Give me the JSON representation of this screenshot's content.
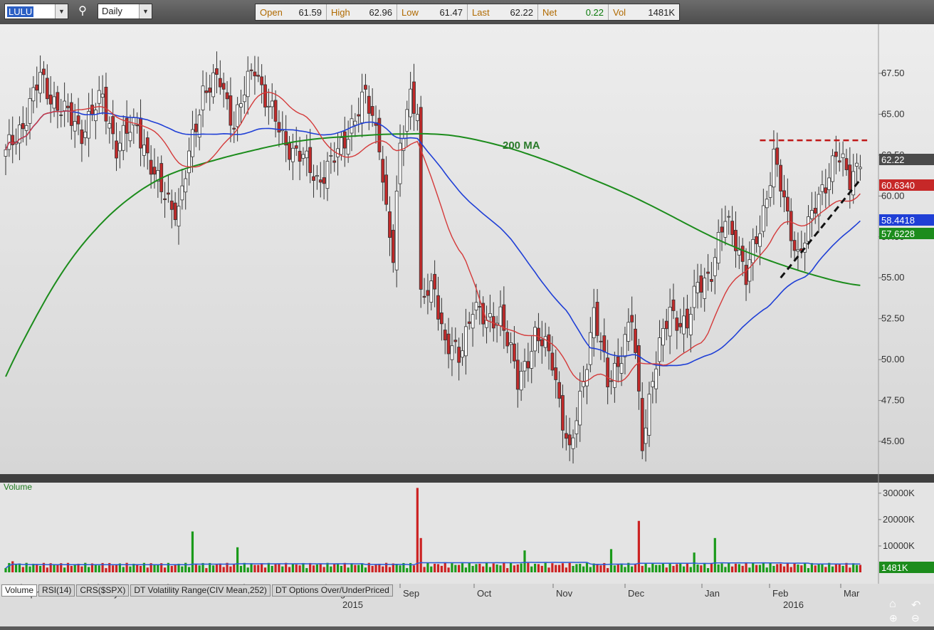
{
  "toolbar": {
    "symbol": "LULU",
    "period": "Daily",
    "quote": [
      {
        "label": "Open",
        "value": "61.59"
      },
      {
        "label": "High",
        "value": "62.96"
      },
      {
        "label": "Low",
        "value": "61.47"
      },
      {
        "label": "Last",
        "value": "62.22"
      },
      {
        "label": "Net",
        "value": "0.22"
      },
      {
        "label": "Vol",
        "value": "1481K"
      }
    ]
  },
  "colors": {
    "up": "#ffffff",
    "down": "#c12a2a",
    "ma20": "#d43a3a",
    "ma50": "#1f3fd6",
    "ma200": "#1c8c1c",
    "plot_bg": "#e8e8e8",
    "volume_avg": "#2a5bd8"
  },
  "chart_data": [
    {
      "type": "candlestick",
      "title": "",
      "xlabel": "",
      "ylabel": "",
      "ylim": [
        43.0,
        70.5
      ],
      "yticks": [
        "45.00",
        "47.50",
        "50.00",
        "52.50",
        "55.00",
        "57.50",
        "60.00",
        "62.50",
        "65.00",
        "67.50"
      ],
      "x_month_labels": [
        "Apr",
        "May",
        "Jun",
        "Jul",
        "Aug",
        "Sep",
        "Oct",
        "Nov",
        "Dec",
        "Jan",
        "Feb",
        "Mar"
      ],
      "x_year_labels": [
        "2015",
        "2016"
      ],
      "price_anchor_points": [
        [
          0,
          62.5
        ],
        [
          5,
          64.5
        ],
        [
          10,
          67.2
        ],
        [
          15,
          65.5
        ],
        [
          22,
          64.0
        ],
        [
          28,
          66.0
        ],
        [
          32,
          63.0
        ],
        [
          38,
          64.5
        ],
        [
          43,
          61.0
        ],
        [
          50,
          59.0
        ],
        [
          54,
          63.5
        ],
        [
          57,
          66.5
        ],
        [
          62,
          67.0
        ],
        [
          66,
          64.5
        ],
        [
          72,
          68.0
        ],
        [
          76,
          65.5
        ],
        [
          80,
          63.5
        ],
        [
          85,
          62.5
        ],
        [
          90,
          61.0
        ],
        [
          96,
          62.5
        ],
        [
          100,
          64.5
        ],
        [
          104,
          66.0
        ],
        [
          108,
          63.5
        ],
        [
          110,
          59.0
        ],
        [
          112,
          56.0
        ],
        [
          114,
          63.0
        ],
        [
          117,
          66.5
        ],
        [
          119,
          65.0
        ],
        [
          120,
          53.5
        ],
        [
          124,
          54.5
        ],
        [
          127,
          51.0
        ],
        [
          131,
          50.0
        ],
        [
          135,
          53.5
        ],
        [
          139,
          52.0
        ],
        [
          143,
          53.0
        ],
        [
          148,
          48.5
        ],
        [
          153,
          51.5
        ],
        [
          158,
          50.0
        ],
        [
          163,
          44.0
        ],
        [
          166,
          47.5
        ],
        [
          170,
          53.0
        ],
        [
          174,
          48.5
        ],
        [
          178,
          50.5
        ],
        [
          181,
          52.5
        ],
        [
          184,
          45.0
        ],
        [
          187,
          49.0
        ],
        [
          192,
          53.0
        ],
        [
          197,
          52.0
        ],
        [
          200,
          54.5
        ],
        [
          204,
          55.5
        ],
        [
          208,
          58.5
        ],
        [
          211,
          57.5
        ],
        [
          214,
          55.0
        ],
        [
          218,
          58.0
        ],
        [
          222,
          62.5
        ],
        [
          226,
          58.5
        ],
        [
          229,
          56.5
        ],
        [
          232,
          58.0
        ],
        [
          236,
          60.5
        ],
        [
          240,
          62.5
        ],
        [
          244,
          61.0
        ],
        [
          247,
          62.5
        ]
      ],
      "highlight_lines": [
        {
          "name": "200 MA",
          "label": "200 MA"
        }
      ],
      "resistance_level": 63.4,
      "trendline": {
        "start": [
          224,
          55.0
        ],
        "end": [
          247,
          61.0
        ]
      },
      "last_values": [
        {
          "name": "Last",
          "value": "62.22",
          "color": "#4a4a4a"
        },
        {
          "name": "20 MA",
          "value": "60.6340",
          "color": "#c62828"
        },
        {
          "name": "50 MA",
          "value": "58.4418",
          "color": "#1f3fd6"
        },
        {
          "name": "200 MA",
          "value": "57.6228",
          "color": "#1c8c1c"
        }
      ]
    },
    {
      "type": "bar",
      "title": "Volume",
      "yticks": [
        "10000K",
        "20000K",
        "30000K"
      ],
      "ylim": [
        0,
        34000
      ],
      "last_value": "1481K",
      "spikes": [
        [
          2,
          4200
        ],
        [
          54,
          15500
        ],
        [
          67,
          9500
        ],
        [
          119,
          32000
        ],
        [
          120,
          13000
        ],
        [
          150,
          8300
        ],
        [
          175,
          8800
        ],
        [
          183,
          19500
        ],
        [
          199,
          7500
        ],
        [
          205,
          13000
        ]
      ]
    }
  ],
  "indicator_tabs": [
    "Volume",
    "RSI(14)",
    "CRS($SPX)",
    "DT Volatility Range(CIV Mean,252)",
    "DT Options Over/UnderPriced"
  ]
}
